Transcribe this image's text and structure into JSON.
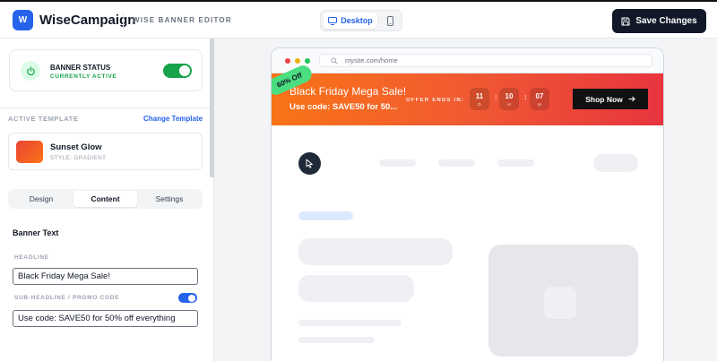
{
  "header": {
    "logo_letter": "W",
    "app_name": "WiseCampaign",
    "editor_label": "WISE BANNER EDITOR",
    "device_desktop_label": "Desktop",
    "save_label": "Save Changes"
  },
  "sidebar": {
    "status": {
      "title": "BANNER STATUS",
      "subtitle": "CURRENTLY ACTIVE",
      "enabled": true
    },
    "active_template_label": "ACTIVE TEMPLATE",
    "change_template_label": "Change Template",
    "template": {
      "name": "Sunset Glow",
      "style": "STYLE: GRADIENT"
    },
    "tabs": [
      {
        "label": "Design",
        "active": false
      },
      {
        "label": "Content",
        "active": true
      },
      {
        "label": "Settings",
        "active": false
      }
    ],
    "banner_text_title": "Banner Text",
    "headline_label": "HEADLINE",
    "headline_value": "Black Friday Mega Sale!",
    "subheadline_label": "SUB-HEADLINE / PROMO CODE",
    "subheadline_enabled": true,
    "subheadline_value": "Use code: SAVE50 for 50% off everything"
  },
  "preview": {
    "url": "mysite.com/home",
    "banner": {
      "badge": "60% Off",
      "headline": "Black Friday Mega Sale!",
      "sub": "Use code: SAVE50 for 50...",
      "offer_label": "OFFER ENDS IN:",
      "countdown": [
        {
          "value": "11",
          "unit": "D"
        },
        {
          "value": "10",
          "unit": "H"
        },
        {
          "value": "07",
          "unit": "M"
        }
      ],
      "cta": "Shop Now"
    }
  },
  "colors": {
    "accent_blue": "#2563eb",
    "status_green": "#16a34a",
    "badge_green": "#4ade80",
    "banner_gradient_start": "#f97316",
    "banner_gradient_end": "#e8343f",
    "dark": "#111827"
  }
}
